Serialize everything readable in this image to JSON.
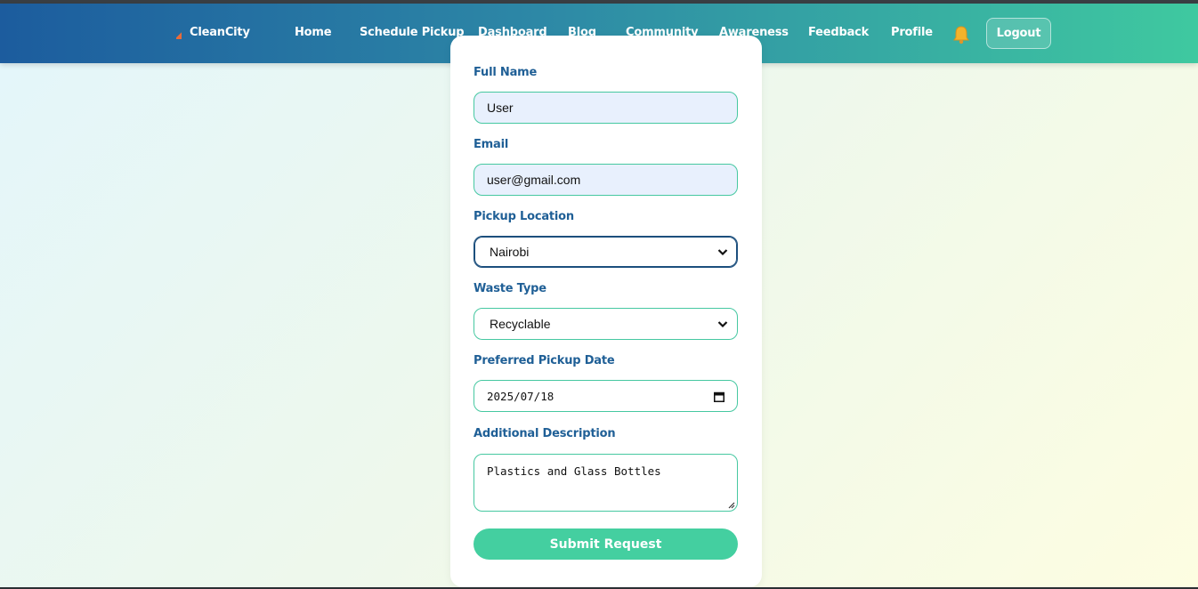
{
  "navbar": {
    "brand": "CleanCity",
    "links": [
      "Home",
      "Schedule Pickup",
      "Dashboard",
      "Blog",
      "Community",
      "Awareness",
      "Feedback",
      "Profile"
    ],
    "notification_icon": "bell-icon",
    "logout_label": "Logout"
  },
  "form": {
    "full_name": {
      "label": "Full Name",
      "value": "User"
    },
    "email": {
      "label": "Email",
      "value": "user@gmail.com"
    },
    "pickup_location": {
      "label": "Pickup Location",
      "selected": "Nairobi"
    },
    "waste_type": {
      "label": "Waste Type",
      "selected": "Recyclable"
    },
    "pickup_date": {
      "label": "Preferred Pickup Date",
      "value": "2025/07/18"
    },
    "description": {
      "label": "Additional Description",
      "value": "Plastics and Glass Bottles"
    },
    "submit_label": "Submit Request"
  },
  "colors": {
    "nav_start": "#1c5c9e",
    "nav_end": "#3fc9a0",
    "label": "#1f5f96",
    "accent": "#44cfa0",
    "input_fill": "#e8f0fd"
  }
}
